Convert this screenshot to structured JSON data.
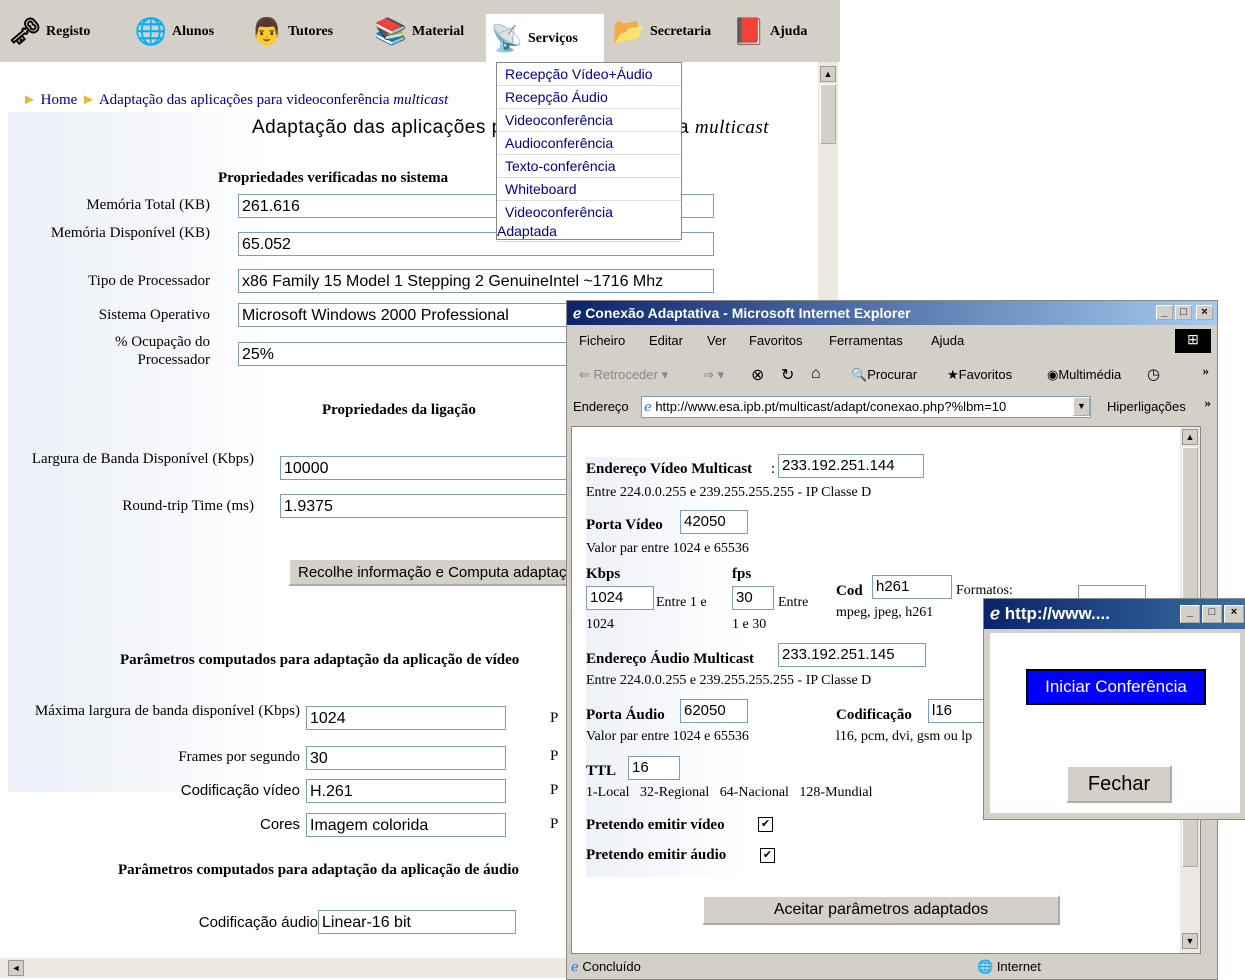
{
  "nav": {
    "items": [
      {
        "label": "Registo",
        "icon": "key-icon"
      },
      {
        "label": "Alunos",
        "icon": "globe-people-icon"
      },
      {
        "label": "Tutores",
        "icon": "teacher-icon"
      },
      {
        "label": "Material",
        "icon": "books-icon"
      },
      {
        "label": "Serviços",
        "icon": "satellite-icon"
      },
      {
        "label": "Secretaria",
        "icon": "folder-icon"
      },
      {
        "label": "Ajuda",
        "icon": "help-book-icon"
      }
    ]
  },
  "dropdown": {
    "items": [
      "Recepção Vídeo+Áudio",
      "Recepção Áudio",
      "Videoconferência",
      "Audioconferência",
      "Texto-conferência",
      "Whiteboard",
      "Videoconferência",
      "Adaptada"
    ]
  },
  "breadcrumb": {
    "home": "Home",
    "current": "Adaptação das aplicações para videoconferência",
    "current_em": "multicast"
  },
  "page": {
    "title": "Adaptação das aplicações para videoconferência",
    "title_em": "multicast",
    "sys_section": "Propriedades verificadas no sistema",
    "mem_total_label": "Memória Total (KB)",
    "mem_total": "261.616",
    "mem_disp_label": "Memória Disponível (KB)",
    "mem_disp": "65.052",
    "proc_type_label": "Tipo de Processador",
    "proc_type": "x86 Family 15 Model 1 Stepping 2 GenuineIntel ~1716 Mhz",
    "os_label": "Sistema Operativo",
    "os": "Microsoft Windows 2000 Professional",
    "cpu_label": "% Ocupação do Processador",
    "cpu": "25%",
    "link_section": "Propriedades da ligação",
    "bw_label": "Largura de Banda Disponível (Kbps)",
    "bw": "10000",
    "rtt_label": "Round-trip Time (ms)",
    "rtt": "1.9375",
    "compute_button": "Recolhe informação e Computa adaptação",
    "video_section": "Parâmetros computados para adaptação da aplicação de vídeo",
    "max_bw_label": "Máxima largura de banda disponível (Kbps)",
    "max_bw": "1024",
    "fps_label": "Frames por segundo",
    "fps": "30",
    "vcodec_label": "Codificação vídeo",
    "vcodec": "H.261",
    "colors_label": "Cores",
    "colors": "Imagem colorida",
    "p_marker": "P",
    "audio_section": "Parâmetros computados para adaptação da aplicação de áudio",
    "acodec_label": "Codificação áudio",
    "acodec": "Linear-16 bit"
  },
  "ie": {
    "title": "Conexão Adaptativa - Microsoft Internet Explorer",
    "menu": [
      "Ficheiro",
      "Editar",
      "Ver",
      "Favoritos",
      "Ferramentas",
      "Ajuda"
    ],
    "toolbar": {
      "back": "Retroceder",
      "search": "Procurar",
      "favorites": "Favoritos",
      "media": "Multimédia"
    },
    "address_label": "Endereço",
    "address": "http://www.esa.ipb.pt/multicast/adapt/conexao.php?%lbm=10",
    "links_label": "Hiperligações",
    "status_left": "Concluído",
    "status_zone": "Internet",
    "form": {
      "video_mc_label": "Endereço Vídeo Multicast",
      "video_mc": "233.192.251.144",
      "video_mc_hint": "Entre 224.0.0.255 e 239.255.255.255 - IP Classe D",
      "video_port_label": "Porta Vídeo",
      "video_port": "42050",
      "video_port_hint": "Valor par entre 1024 e 65536",
      "kbps_label": "Kbps",
      "kbps": "1024",
      "kbps_hint1": "Entre 1 e",
      "kbps_hint2": "1024",
      "fps_label": "fps",
      "fps": "30",
      "fps_hint1": "Entre",
      "fps_hint2": "1 e 30",
      "cod_label": "Cod",
      "cod": "h261",
      "cod_hint": "mpeg, jpeg, h261",
      "formatos_label": "Formatos:",
      "audio_mc_label": "Endereço Áudio Multicast",
      "audio_mc": "233.192.251.145",
      "audio_mc_hint": "Entre 224.0.0.255 e 239.255.255.255 - IP Classe D",
      "audio_port_label": "Porta Áudio",
      "audio_port": "62050",
      "audio_port_hint": "Valor par entre 1024 e 65536",
      "acod_label": "Codificação",
      "acod": "l16",
      "acod_hint": "l16, pcm, dvi, gsm ou lp",
      "ttl_label": "TTL",
      "ttl": "16",
      "ttl_hint": "1-Local   32-Regional   64-Nacional   128-Mundial",
      "emit_video_label": "Pretendo emitir vídeo",
      "emit_audio_label": "Pretendo emitir áudio",
      "accept_button": "Aceitar parâmetros adaptados"
    }
  },
  "popup": {
    "title": "http://www....",
    "start_button": "Iniciar Conferência",
    "close_button": "Fechar"
  },
  "colors": {
    "title_bar": "#0a246a",
    "face": "#d4d0c8",
    "link": "#00008b",
    "start_btn": "#0000ff"
  }
}
